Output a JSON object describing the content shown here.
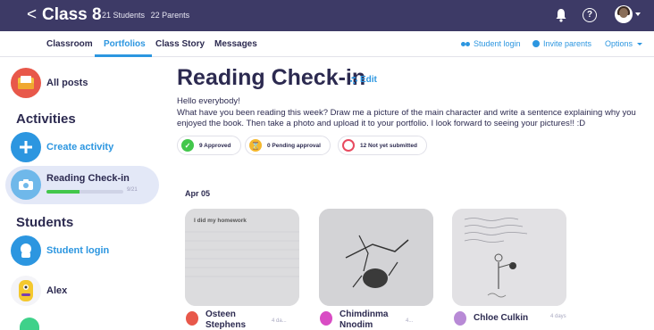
{
  "topbar": {
    "back": "<",
    "class_name": "Class 8",
    "students": "21 Students",
    "parents": "22 Parents",
    "help": "?"
  },
  "nav": {
    "tabs": [
      "Classroom",
      "Portfolios",
      "Class Story",
      "Messages"
    ],
    "active_tab": "Portfolios",
    "student_login": "Student login",
    "invite_parents": "Invite parents",
    "options": "Options"
  },
  "sidebar": {
    "all_posts": "All posts",
    "activities_heading": "Activities",
    "create_activity": "Create activity",
    "activity_name": "Reading Check-in",
    "activity_progress": 0.43,
    "activity_progress_label": "9/21",
    "students_heading": "Students",
    "student_login": "Student login",
    "student_1": "Alex"
  },
  "main": {
    "title": "Reading Check-in",
    "edit": "Edit",
    "desc_line1": "Hello everybody!",
    "desc_line2": "What have you been reading this week? Draw me a picture of the main character and write a sentence explaining why you enjoyed the book. Then take a photo and upload it to your portfolio. I look forward to seeing your pictures!! :D",
    "approved": "9 Approved",
    "pending": "0 Pending approval",
    "not_submitted": "12 Not yet submitted",
    "date": "Apr 05",
    "card1_text": "I did my homework",
    "cards": [
      {
        "name_line1": "Osteen",
        "name_line2": "Stephens",
        "time": "4 da..."
      },
      {
        "name_line1": "Chimdinma",
        "name_line2": "Nnodim",
        "time": "4..."
      },
      {
        "name_line1": "Chloe Culkin",
        "name_line2": "",
        "time": "4 days"
      }
    ]
  },
  "colors": {
    "topbar": "#3d3a66",
    "accent": "#2c96e0",
    "approved": "#42c74b",
    "pending": "#f5b82e",
    "not_submitted": "#e84a5f"
  }
}
